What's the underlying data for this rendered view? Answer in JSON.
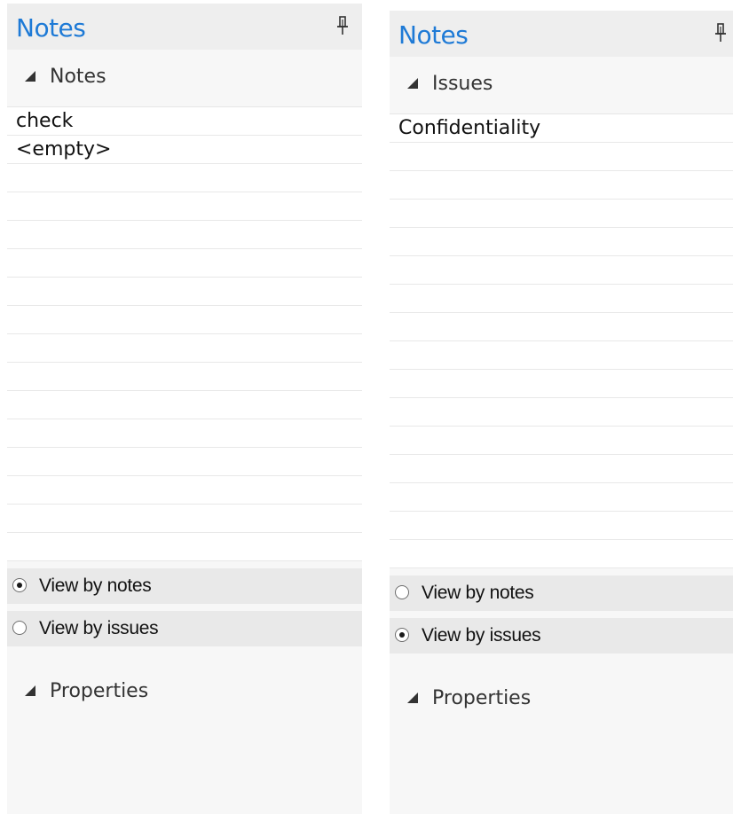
{
  "panels": [
    {
      "title": "Notes",
      "section_label": "Notes",
      "rows": [
        "check",
        "<empty>",
        "",
        "",
        "",
        "",
        "",
        "",
        "",
        "",
        "",
        "",
        "",
        "",
        "",
        ""
      ],
      "radio_notes": "View by notes",
      "radio_issues": "View by issues",
      "selected_view": "notes",
      "properties_label": "Properties"
    },
    {
      "title": "Notes",
      "section_label": "Issues",
      "rows": [
        "Confidentiality",
        "",
        "",
        "",
        "",
        "",
        "",
        "",
        "",
        "",
        "",
        "",
        "",
        "",
        "",
        ""
      ],
      "radio_notes": "View by notes",
      "radio_issues": "View by issues",
      "selected_view": "issues",
      "properties_label": "Properties"
    }
  ],
  "icons": {
    "pin": "pin-icon",
    "section_toggle": "triangle-collapse-icon"
  },
  "colors": {
    "title": "#1e7ad6",
    "panel_bg": "#f7f7f7",
    "radio_bg": "#e9e9e9"
  }
}
